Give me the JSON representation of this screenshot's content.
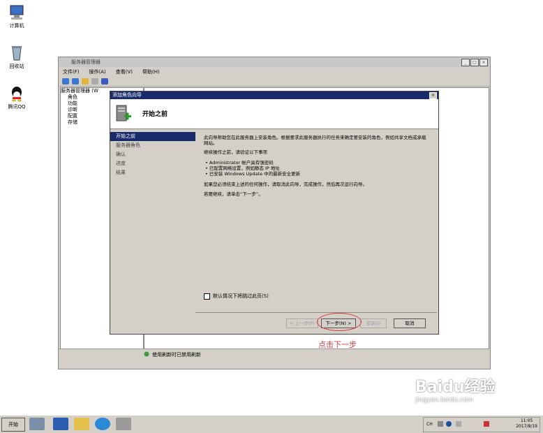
{
  "desktop": {
    "icons": [
      {
        "label": "计算机"
      },
      {
        "label": "回收站"
      },
      {
        "label": "腾讯QQ"
      }
    ]
  },
  "server_manager": {
    "title": "服务器管理器",
    "menu": [
      "文件(F)",
      "操作(A)",
      "查看(V)",
      "帮助(H)"
    ],
    "tree": [
      "服务器管理器 (W",
      "角色",
      "功能",
      "诊断",
      "配置",
      "存储"
    ],
    "status_text": "使用刷新时已禁用刷新"
  },
  "wizard": {
    "title": "添加角色向导",
    "header": "开始之前",
    "steps": [
      "开始之前",
      "服务器角色",
      "确认",
      "进度",
      "结果"
    ],
    "paragraphs": [
      "此向导帮助您在此服务器上安装角色。根据要求此服务器执行的任务来确定要安装的角色，例如共享文档或承载网站。",
      "继续操作之前，请验证以下事项",
      "• Administrator 帐户具有强密码",
      "• 已配置网络设置，例如静态 IP 地址",
      "• 已安装 Windows Update 中的最新安全更新",
      "如果您必须结束上述的任何操作，请取消此向导，完成操作，然后再次运行向导。",
      "若要继续，请单击“下一步”。"
    ],
    "skip_checkbox": "默认情况下将跳过此页(S)",
    "buttons": {
      "prev": "< 上一步(P)",
      "next": "下一步(N) >",
      "install": "安装(I)",
      "cancel": "取消"
    }
  },
  "annotation": "点击下一步",
  "taskbar": {
    "start": "开始",
    "tray_lang": "CH",
    "time": "11:05",
    "date": "2017/8/19"
  },
  "watermark": {
    "brand": "Baidu经验",
    "url": "jingyan.baidu.com"
  }
}
